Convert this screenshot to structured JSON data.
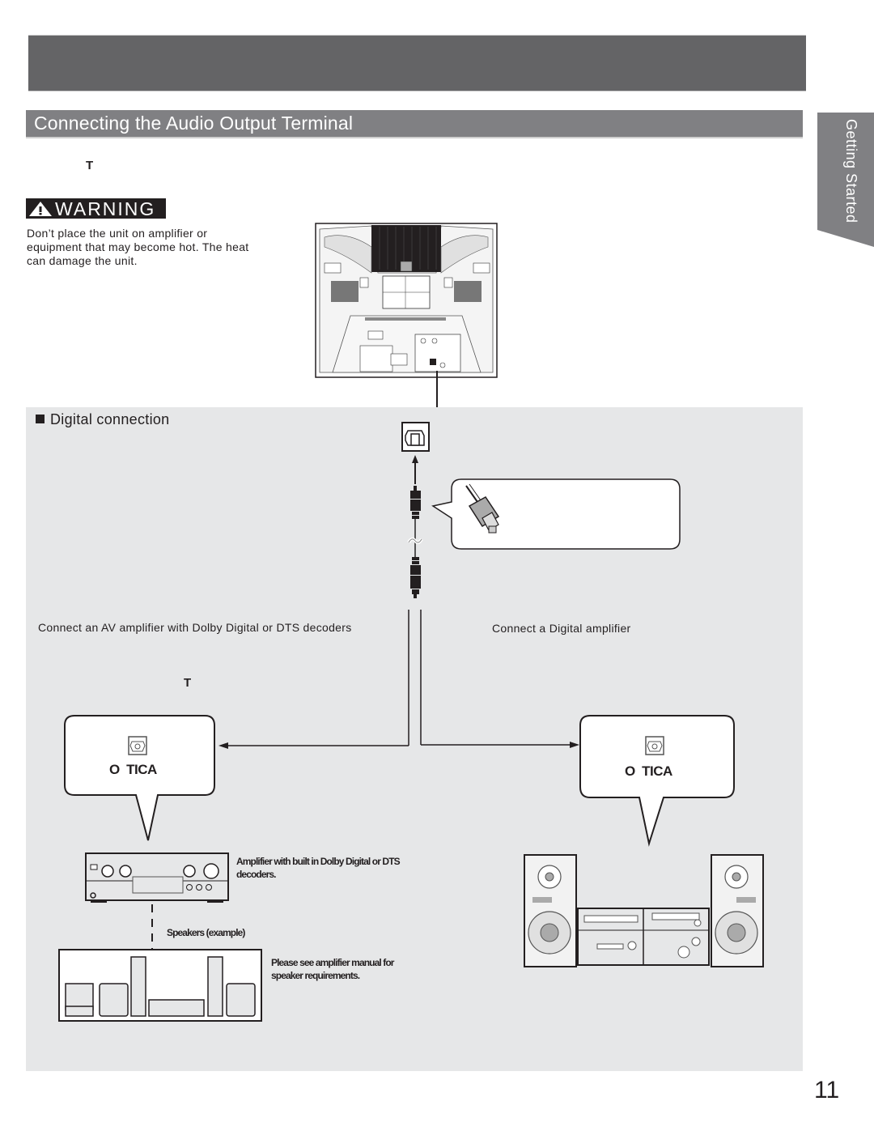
{
  "header": {
    "section_title": "Connecting the Audio Output Terminal",
    "side_tab_label": "Getting Started"
  },
  "intro": {
    "fragment": "T"
  },
  "warning": {
    "badge_label": "WARNING",
    "icon": "warning-triangle-icon",
    "body": "Don’t place the unit on amplifier or equipment that may become hot. The heat can damage the unit."
  },
  "digital_connection": {
    "heading": "Digital connection",
    "av_amplifier_caption": "Connect an AV amplifier with Dolby Digital or DTS decoders",
    "av_fragment": "T",
    "digital_amplifier_caption": "Connect a Digital amplifier",
    "optical_left_label": "O  TICA",
    "optical_right_label": "O  TICA",
    "amplifier_caption": "Amplifier with built in Dolby Digital or DTS decoders.",
    "speakers_caption": "Speakers (example)",
    "speaker_requirements_caption": "Please see amplifier manual for speaker requirements."
  },
  "footer": {
    "page_number": "11"
  },
  "colors": {
    "top_bar": "#646466",
    "section_bar": "#808083",
    "panel_background": "#e6e7e8",
    "text": "#231f20"
  }
}
